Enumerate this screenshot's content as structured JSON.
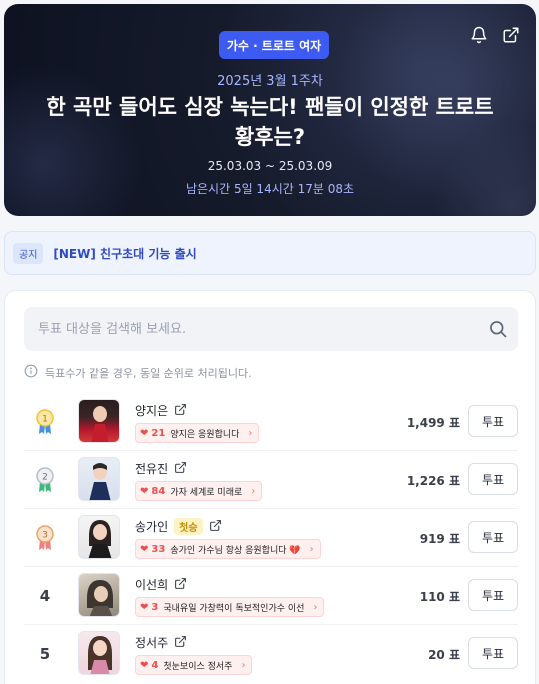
{
  "hero": {
    "category": "가수 · 트로트 여자",
    "week": "2025년 3월 1주차",
    "title": "한 곡만 들어도 심장 녹는다! 팬들이 인정한 트로트 황후는?",
    "dates": "25.03.03 ~ 25.03.09",
    "remaining": "남은시간 5일 14시간 17분 08초",
    "icons": [
      "bell-icon",
      "share-icon"
    ]
  },
  "notice": {
    "tag": "공지",
    "text": "[NEW] 친구초대 기능 출시"
  },
  "search": {
    "placeholder": "투표 대상을 검색해 보세요."
  },
  "info_text": "득표수가 같을 경우, 동일 순위로 처리됩니다.",
  "colors": {
    "accent": "#3d5af1",
    "heart": "#f04d4d",
    "gold": "#f2c230",
    "silver": "#b8bfcb",
    "bronze": "#e8a36a"
  },
  "rankings": [
    {
      "rank": "1",
      "name": "양지은",
      "badge": "",
      "cheer_count": "21",
      "cheer_text": "양지은 응원합니다",
      "votes": "1,499 표",
      "vote_label": "투표"
    },
    {
      "rank": "2",
      "name": "전유진",
      "badge": "",
      "cheer_count": "84",
      "cheer_text": "가자 세계로 미래로",
      "votes": "1,226 표",
      "vote_label": "투표"
    },
    {
      "rank": "3",
      "name": "송가인",
      "badge": "첫승",
      "cheer_count": "33",
      "cheer_text": "송가인 가수님 항상 응원합니다 💔",
      "votes": "919 표",
      "vote_label": "투표"
    },
    {
      "rank": "4",
      "name": "이선희",
      "badge": "",
      "cheer_count": "3",
      "cheer_text": "국내유일 가창력이 독보적인가수 이선",
      "votes": "110 표",
      "vote_label": "투표"
    },
    {
      "rank": "5",
      "name": "정서주",
      "badge": "",
      "cheer_count": "4",
      "cheer_text": "첫눈보이스 정서주",
      "votes": "20 표",
      "vote_label": "투표"
    }
  ]
}
